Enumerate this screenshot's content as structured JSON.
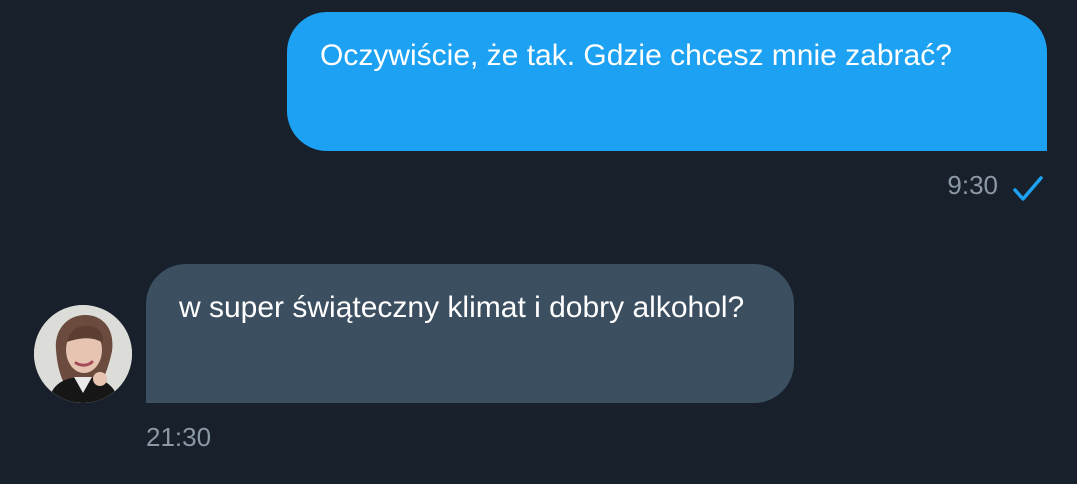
{
  "conversation": {
    "messages": [
      {
        "direction": "outgoing",
        "text": "Oczywiście, że tak. Gdzie chcesz mnie zabrać?",
        "time": "9:30",
        "status_icon": "checkmark-icon",
        "bubble_color": "#1da1f2"
      },
      {
        "direction": "incoming",
        "text": "w super świąteczny klimat i dobry alkohol?",
        "time": "21:30",
        "avatar_icon": "avatar",
        "bubble_color": "#3c4f60"
      }
    ]
  },
  "colors": {
    "background": "#17202b",
    "accent": "#1da1f2",
    "incoming_bubble": "#3c4f60",
    "timestamp": "#8b98a5",
    "text": "#ffffff"
  }
}
